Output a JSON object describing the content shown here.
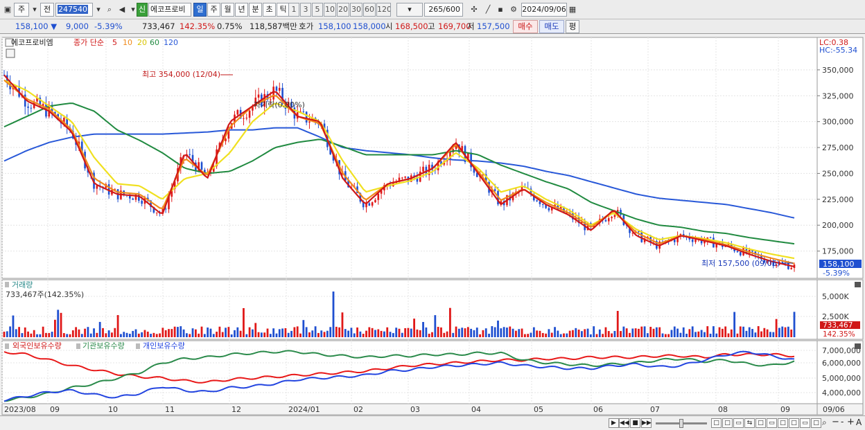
{
  "toolbar": {
    "chk_label": "주",
    "mode_label": "전",
    "code": "247540",
    "new_badge": "신",
    "name": "에코프로비",
    "periods": [
      "일",
      "주",
      "월",
      "년",
      "분",
      "초",
      "틱"
    ],
    "active_period": "일",
    "nums": [
      "1",
      "3",
      "5",
      "10",
      "20",
      "30",
      "60",
      "120"
    ],
    "count": "265",
    "count_total": "/600",
    "date": "2024/09/06"
  },
  "quote": {
    "price": "158,100",
    "change": "9,000",
    "change_pct": "-5.39%",
    "volume": "733,467",
    "vol_ratio": "142.35%",
    "turnover": "0.75%",
    "amount": "118,587백만",
    "hoga_label": "호가",
    "ask": "158,100",
    "bid": "158,000",
    "open_label": "시",
    "open": "168,500",
    "high_label": "고",
    "high": "169,700",
    "low_label": "저",
    "low": "157,500",
    "buy": "매수",
    "sell": "매도",
    "eval": "평"
  },
  "price_pane": {
    "name": "에코프로비엠",
    "ma_label": "종가 단순",
    "ma_periods": [
      "5",
      "10",
      "20",
      "60",
      "120"
    ],
    "ma_colors": [
      "#d01818",
      "#f08a1a",
      "#f0e020",
      "#208a40",
      "#2858d8"
    ],
    "lc": "LC:0.38",
    "hc": "HC:-55.34",
    "high_note": "최고 354,000 (12/04)",
    "low_note": "최저 157,500 (09/06)",
    "mid_note": "자기락(0.00%)",
    "price_tag": "158,100",
    "pct_tag": "-5.39%",
    "y_ticks": [
      "350,000",
      "325,000",
      "300,000",
      "275,000",
      "250,000",
      "225,000",
      "200,000",
      "175,000"
    ]
  },
  "volume_pane": {
    "title": "거래량",
    "value": "733,467주(142.35%)",
    "y_ticks": [
      "5,000K",
      "2,500K"
    ],
    "tag": "733,467",
    "tag_pct": "142.35%"
  },
  "holdings_pane": {
    "legend": [
      "외국인보유수량",
      "기관보유수량",
      "개인보유수량"
    ],
    "colors": [
      "#e81818",
      "#2a8a4a",
      "#2244e0"
    ],
    "y_ticks": [
      "7,000,000",
      "6,000,000",
      "5,000,000",
      "4,000,000"
    ]
  },
  "x_axis": {
    "labels": [
      "2023/08",
      "09",
      "10",
      "11",
      "12",
      "2024/01",
      "02",
      "03",
      "04",
      "05",
      "06",
      "07",
      "08",
      "09",
      "09/06"
    ]
  },
  "chart_data": {
    "type": "line",
    "title": "에코프로비엠",
    "x": [
      "2023/08",
      "09",
      "10",
      "11",
      "12",
      "2024/01",
      "02",
      "03",
      "04",
      "05",
      "06",
      "07",
      "08",
      "09"
    ],
    "ylim": [
      150000,
      380000
    ],
    "series": [
      {
        "name": "5",
        "values": [
          345000,
          320000,
          310000,
          290000,
          240000,
          230000,
          228000,
          210000,
          270000,
          245000,
          300000,
          315000,
          330000,
          305000,
          300000,
          245000,
          220000,
          240000,
          245000,
          255000,
          280000,
          250000,
          220000,
          235000,
          220000,
          210000,
          195000,
          215000,
          190000,
          180000,
          190000,
          185000,
          180000,
          172000,
          165000,
          160000
        ]
      },
      {
        "name": "10",
        "values": [
          340000,
          322000,
          312000,
          292000,
          245000,
          232000,
          230000,
          215000,
          265000,
          248000,
          295000,
          315000,
          326000,
          305000,
          298000,
          250000,
          224000,
          240000,
          245000,
          255000,
          278000,
          252000,
          224000,
          235000,
          222000,
          212000,
          198000,
          214000,
          193000,
          182000,
          190000,
          186000,
          181000,
          174000,
          168000,
          163000
        ]
      },
      {
        "name": "20",
        "values": [
          340000,
          330000,
          315000,
          300000,
          265000,
          240000,
          238000,
          225000,
          245000,
          250000,
          270000,
          300000,
          318000,
          310000,
          300000,
          262000,
          232000,
          238000,
          243000,
          252000,
          270000,
          255000,
          232000,
          238000,
          225000,
          215000,
          200000,
          212000,
          196000,
          186000,
          190000,
          187000,
          183000,
          177000,
          172000,
          168000
        ]
      },
      {
        "name": "60",
        "values": [
          295000,
          305000,
          315000,
          318000,
          310000,
          292000,
          282000,
          270000,
          255000,
          250000,
          252000,
          262000,
          275000,
          280000,
          283000,
          276000,
          268000,
          268000,
          268000,
          268000,
          272000,
          268000,
          258000,
          250000,
          242000,
          235000,
          222000,
          214000,
          206000,
          200000,
          198000,
          194000,
          192000,
          188000,
          185000,
          182000
        ]
      },
      {
        "name": "120",
        "values": [
          262000,
          272000,
          280000,
          285000,
          288000,
          288000,
          288000,
          288000,
          289000,
          290000,
          292000,
          292000,
          294000,
          294000,
          285000,
          275000,
          272000,
          270000,
          268000,
          265000,
          263000,
          262000,
          260000,
          257000,
          252000,
          248000,
          242000,
          236000,
          230000,
          226000,
          224000,
          222000,
          220000,
          216000,
          212000,
          207000
        ]
      }
    ]
  }
}
